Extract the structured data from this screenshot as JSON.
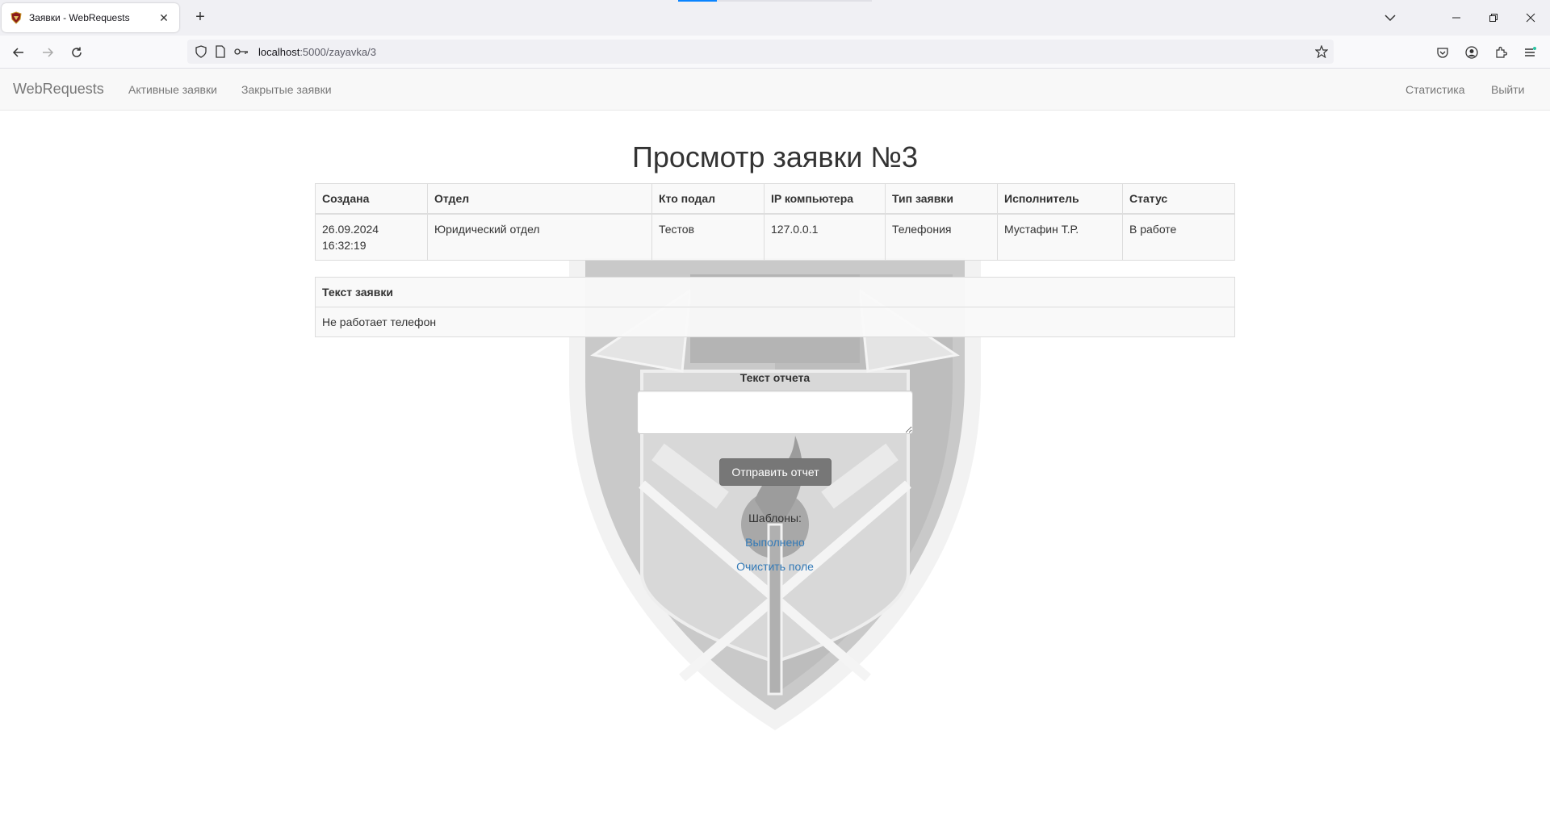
{
  "browser": {
    "tab_title": "Заявки - WebRequests",
    "url_host": "localhost",
    "url_path": ":5000/zayavka/3"
  },
  "site": {
    "brand": "WebRequests",
    "nav_left": [
      "Активные заявки",
      "Закрытые заявки"
    ],
    "nav_right": [
      "Статистика",
      "Выйти"
    ]
  },
  "page": {
    "title": "Просмотр заявки №3"
  },
  "request_table": {
    "headers": [
      "Создана",
      "Отдел",
      "Кто подал",
      "IP компьютера",
      "Тип заявки",
      "Исполнитель",
      "Статус"
    ],
    "row": {
      "created_date": "26.09.2024",
      "created_time": "16:32:19",
      "department": "Юридический отдел",
      "submitted_by": "Тестов",
      "ip": "127.0.0.1",
      "type": "Телефония",
      "executor": "Мустафин Т.Р.",
      "status": "В работе"
    }
  },
  "request_text": {
    "header": "Текст заявки",
    "value": "Не работает телефон"
  },
  "report": {
    "label": "Текст отчета",
    "value": "",
    "submit_label": "Отправить отчет"
  },
  "templates": {
    "label": "Шаблоны:",
    "items": [
      "Выполнено",
      "Очистить поле"
    ]
  },
  "colors": {
    "link": "#337ab7",
    "button": "#777777",
    "navbar_bg": "#f8f8f8",
    "browser_accent": "#0a84ff"
  }
}
